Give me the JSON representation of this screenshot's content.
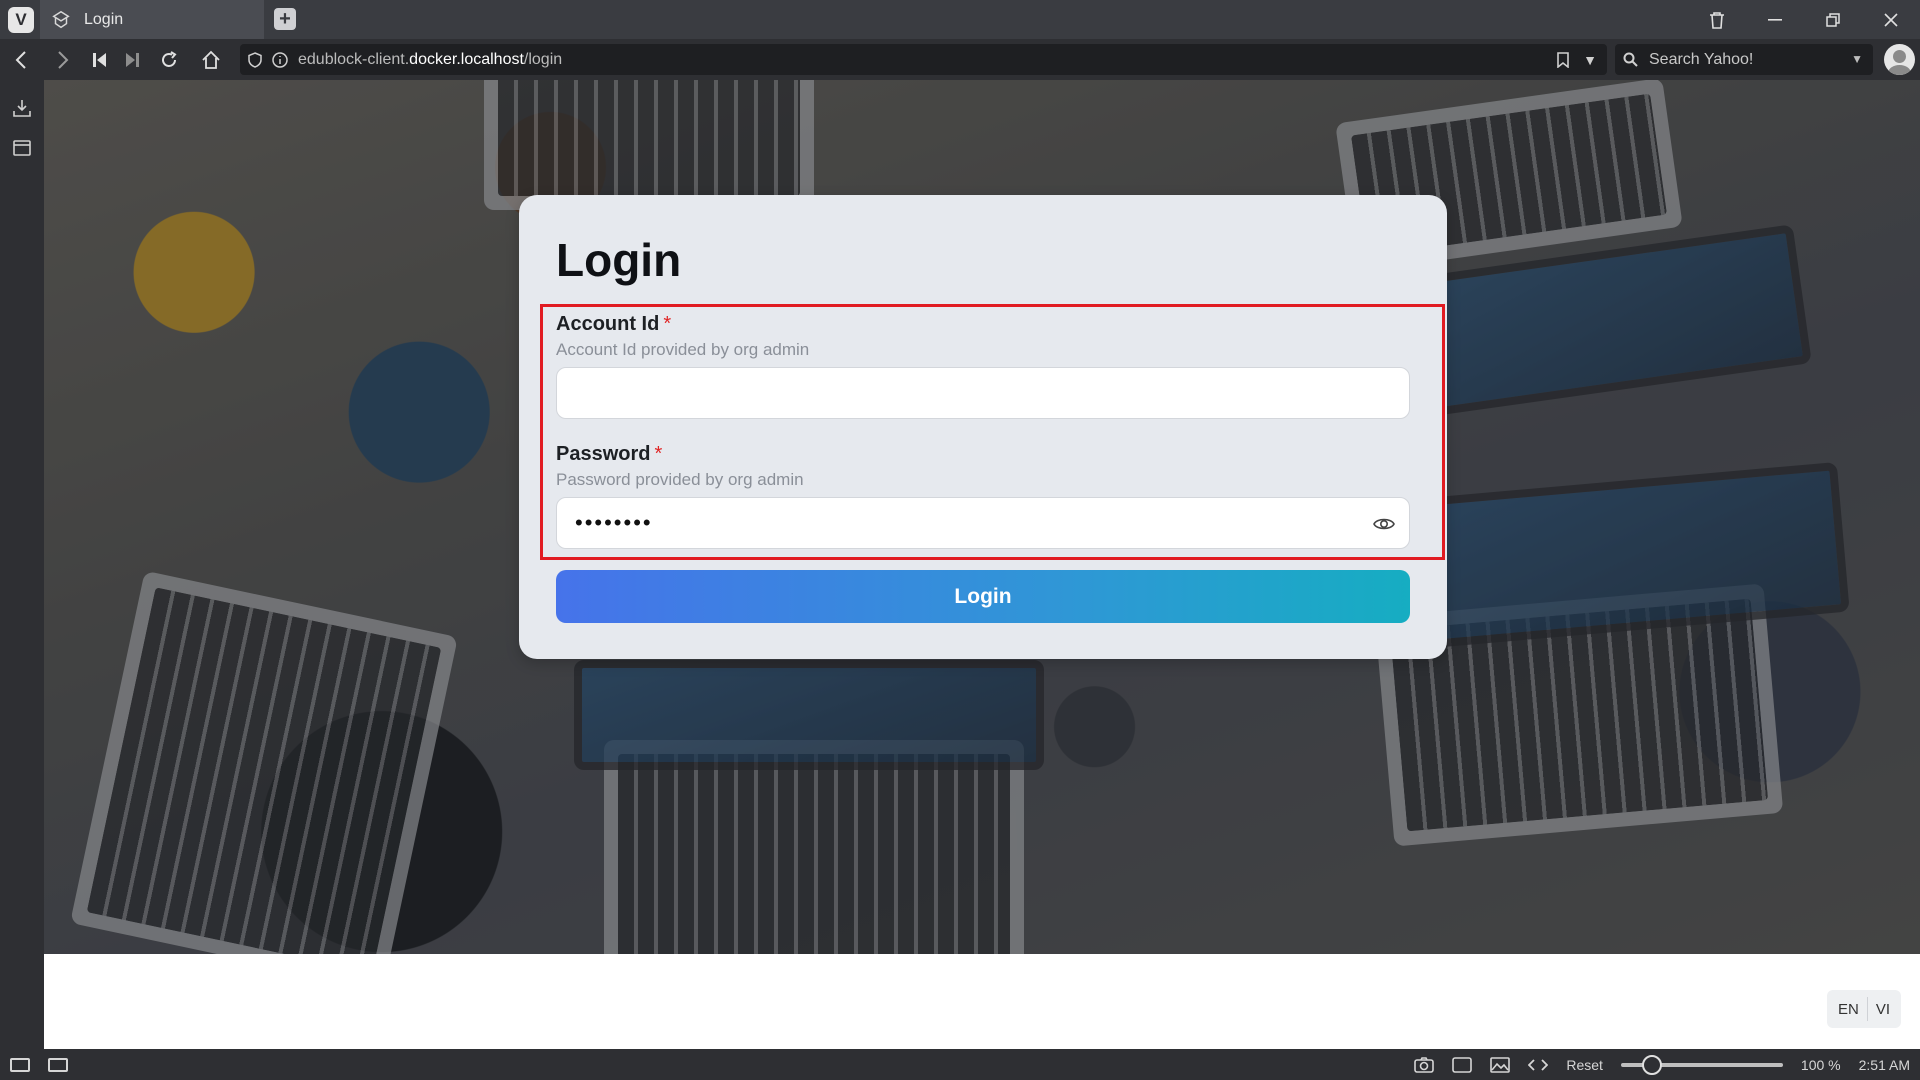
{
  "browser": {
    "tab_title": "Login",
    "url_prefix": "edublock-client.",
    "url_host": "docker.localhost",
    "url_path": "/login",
    "search_placeholder": "Search Yahoo!",
    "status": {
      "reset_label": "Reset",
      "zoom_level": "100 %",
      "zoom_fraction": 0.15,
      "clock": "2:51 AM"
    }
  },
  "login": {
    "title": "Login",
    "account": {
      "label": "Account Id",
      "required_mark": "*",
      "help": "Account Id provided by org admin",
      "value": ""
    },
    "password": {
      "label": "Password",
      "required_mark": "*",
      "help": "Password provided by org admin",
      "masked_value": "••••••••"
    },
    "submit_label": "Login",
    "highlight_color": "#e11b22"
  },
  "language": {
    "options": [
      "EN",
      "VI"
    ]
  }
}
